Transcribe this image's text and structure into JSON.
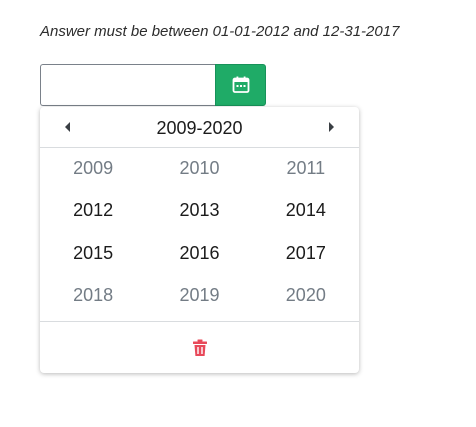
{
  "question": {
    "hint": "Answer must be between 01-01-2012 and 12-31-2017"
  },
  "date_input": {
    "value": "",
    "calendar_icon": "calendar-icon"
  },
  "picker": {
    "range_title": "2009-2020",
    "prev_icon": "caret-left-icon",
    "next_icon": "caret-right-icon",
    "years": [
      [
        {
          "label": "2009",
          "enabled": false
        },
        {
          "label": "2010",
          "enabled": false
        },
        {
          "label": "2011",
          "enabled": false
        }
      ],
      [
        {
          "label": "2012",
          "enabled": true
        },
        {
          "label": "2013",
          "enabled": true
        },
        {
          "label": "2014",
          "enabled": true
        }
      ],
      [
        {
          "label": "2015",
          "enabled": true
        },
        {
          "label": "2016",
          "enabled": true
        },
        {
          "label": "2017",
          "enabled": true
        }
      ],
      [
        {
          "label": "2018",
          "enabled": false
        },
        {
          "label": "2019",
          "enabled": false
        },
        {
          "label": "2020",
          "enabled": false
        }
      ]
    ],
    "clear_icon": "trash-icon"
  },
  "colors": {
    "accent_green": "#1fab67",
    "danger_red": "#e8495a",
    "muted_text": "#737c85"
  }
}
